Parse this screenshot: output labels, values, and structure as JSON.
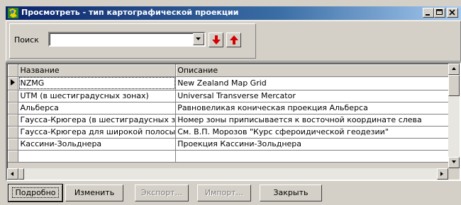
{
  "window": {
    "title": "Просмотреть -  тип картографической проекции"
  },
  "search": {
    "label": "Поиск",
    "value": ""
  },
  "grid": {
    "columns": [
      "Название",
      "Описание"
    ],
    "rows": [
      {
        "name": "NZMG",
        "description": "New Zealand Map Grid"
      },
      {
        "name": "UTM (в шестиградусных зонах)",
        "description": "Universal Transverse Mercator"
      },
      {
        "name": "Альберса",
        "description": "Равновеликая коническая проекция Альберса"
      },
      {
        "name": "Гаусса-Крюгера (в шестиградусных з",
        "description": "Номер зоны приписывается к восточной координате слева"
      },
      {
        "name": "Гаусса-Крюгера для широкой полосы",
        "description": "См. В.П. Морозов \"Курс сфероидической геодезии\""
      },
      {
        "name": "Кассини-Зольднера",
        "description": "Проекция Кассини-Зольднера"
      },
      {
        "name": "",
        "description": ""
      }
    ]
  },
  "buttons": {
    "details": "Подробно",
    "edit": "Изменить",
    "export": "Экспорт...",
    "import": "Импорт...",
    "close": "Закрыть"
  },
  "colors": {
    "titlebar_start": "#0a246a",
    "titlebar_end": "#a6caf0",
    "face": "#d4d0c8",
    "arrow_red": "#d40000"
  },
  "icons": {
    "app": "globe-icon",
    "find_next": "arrow-down-icon",
    "find_prev": "arrow-up-icon"
  }
}
